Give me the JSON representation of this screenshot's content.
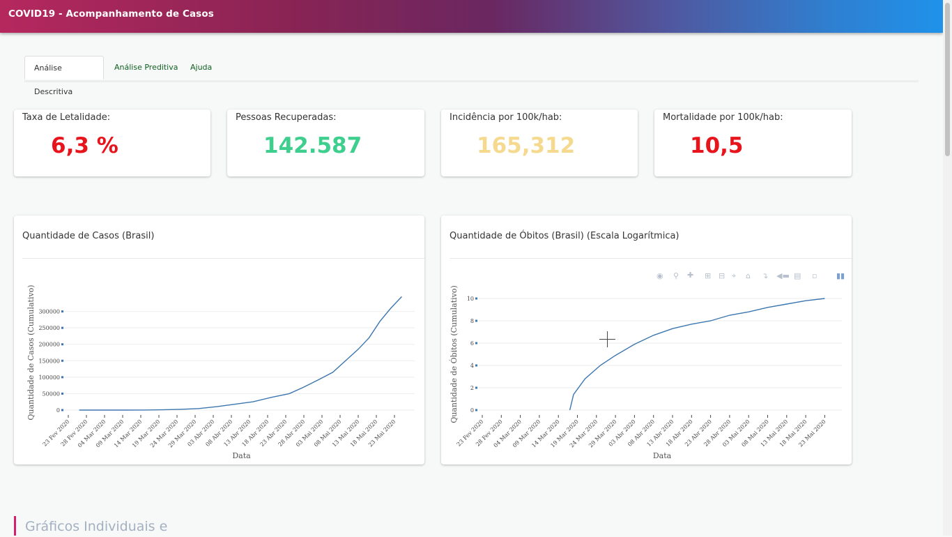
{
  "app": {
    "title": "COVID19 - Acompanhamento de Casos"
  },
  "tabs": [
    {
      "label": "Análise Descritiva",
      "active": true
    },
    {
      "label": "Análise Preditiva",
      "active": false
    },
    {
      "label": "Ajuda",
      "active": false
    }
  ],
  "kpis": [
    {
      "label": "Taxa de Letalidade:",
      "value": "6,3 %",
      "color": "#e8141c"
    },
    {
      "label": "Pessoas Recuperadas:",
      "value": "142.587",
      "color": "#3ecf8e"
    },
    {
      "label": "Incidência por 100k/hab:",
      "value": "165,312",
      "color": "#f5d98f"
    },
    {
      "label": "Mortalidade por 100k/hab:",
      "value": "10,5",
      "color": "#e8141c"
    }
  ],
  "section": {
    "title": "Gráficos Individuais e"
  },
  "chart_data": [
    {
      "type": "line",
      "title": "Quantidade de Casos (Brasil)",
      "xlabel": "Data",
      "ylabel": "Quantidade de Casos (Cumulativo)",
      "x_ticks": [
        "23 Fev 2020",
        "28 Fev 2020",
        "04 Mar 2020",
        "09 Mar 2020",
        "14 Mar 2020",
        "19 Mar 2020",
        "24 Mar 2020",
        "29 Mar 2020",
        "03 Abr 2020",
        "08 Abr 2020",
        "13 Abr 2020",
        "18 Abr 2020",
        "23 Abr 2020",
        "28 Abr 2020",
        "03 Mai 2020",
        "08 Mai 2020",
        "13 Mai 2020",
        "18 Mai 2020",
        "23 Mai 2020"
      ],
      "y_ticks": [
        0,
        50000,
        100000,
        150000,
        200000,
        250000,
        300000
      ],
      "ylim": [
        0,
        350000
      ],
      "line_color": "#3b76af",
      "series": [
        {
          "x": [
            "2020-02-26",
            "2020-03-05",
            "2020-03-10",
            "2020-03-15",
            "2020-03-20",
            "2020-03-25",
            "2020-03-30",
            "2020-04-04",
            "2020-04-09",
            "2020-04-14",
            "2020-04-19",
            "2020-04-24",
            "2020-04-28",
            "2020-05-02",
            "2020-05-06",
            "2020-05-10",
            "2020-05-13",
            "2020-05-16",
            "2020-05-19",
            "2020-05-22",
            "2020-05-25"
          ],
          "y": [
            1,
            8,
            34,
            200,
            900,
            2400,
            4600,
            10300,
            17900,
            25300,
            38600,
            50000,
            70000,
            92000,
            115000,
            155000,
            185000,
            220000,
            270000,
            310000,
            345000
          ]
        }
      ]
    },
    {
      "type": "line",
      "title": "Quantidade de Óbitos (Brasil) (Escala Logarítmica)",
      "xlabel": "Data",
      "ylabel": "Quantidade de Óbitos (Cumulativo)",
      "x_ticks": [
        "23 Fev 2020",
        "28 Fev 2020",
        "04 Mar 2020",
        "09 Mar 2020",
        "14 Mar 2020",
        "19 Mar 2020",
        "24 Mar 2020",
        "29 Mar 2020",
        "03 Abr 2020",
        "08 Abr 2020",
        "13 Abr 2020",
        "18 Abr 2020",
        "23 Abr 2020",
        "28 Abr 2020",
        "03 Mai 2020",
        "08 Mai 2020",
        "13 Mai 2020",
        "18 Mai 2020",
        "23 Mai 2020"
      ],
      "y_ticks": [
        0,
        2,
        4,
        6,
        8,
        10
      ],
      "ylim": [
        0,
        10
      ],
      "line_color": "#3b76af",
      "series": [
        {
          "x": [
            "2020-03-17",
            "2020-03-18",
            "2020-03-21",
            "2020-03-25",
            "2020-03-29",
            "2020-04-03",
            "2020-04-08",
            "2020-04-13",
            "2020-04-18",
            "2020-04-23",
            "2020-04-28",
            "2020-05-03",
            "2020-05-08",
            "2020-05-13",
            "2020-05-18",
            "2020-05-23"
          ],
          "y": [
            0,
            1.4,
            2.8,
            4.0,
            4.9,
            5.9,
            6.7,
            7.3,
            7.7,
            8.0,
            8.5,
            8.8,
            9.2,
            9.5,
            9.8,
            10.0
          ]
        }
      ]
    }
  ]
}
